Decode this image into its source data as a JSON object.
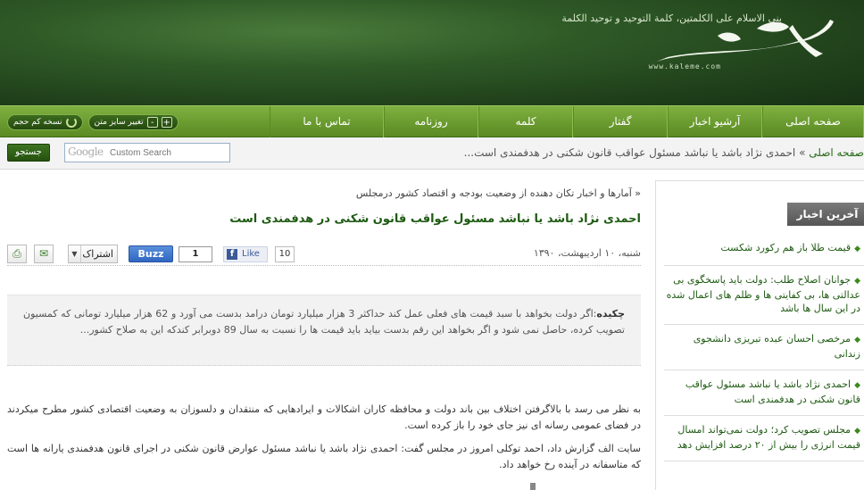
{
  "header": {
    "slogan": "بنی الاسلام علی الکلمتین، کلمة التوحید و توحید الکلمة",
    "logo_text": "کلمه",
    "logo_url": "www.kaleme.com"
  },
  "nav": {
    "items": [
      "صفحه اصلی",
      "آرشیو اخبار",
      "گفتار",
      "کلمه",
      "روزنامه",
      "تماس با ما"
    ],
    "light_version_label": "نسخه کم حجم",
    "font_size_label": "تغییر سایز متن",
    "plus": "+",
    "minus": "-"
  },
  "breadcrumb": {
    "home": "صفحه اصلی",
    "sep": " » ",
    "current": "احمدی نژاد باشد یا نباشد مسئول عواقب قانون شکنی در هدفمندی است..."
  },
  "search": {
    "google_word": "Google",
    "placeholder": "Custom Search",
    "button": "جستجو"
  },
  "article": {
    "kicker": "« آمارها و اخبار تکان دهنده از وضعیت بودجه و اقتصاد کشور درمجلس",
    "title": "احمدی نژاد باشد یا نباشد مسئول عواقب قانون شکنی در هدفمندی است",
    "date": "شنبه، ۱۰ اردیبهشت، ۱۳۹۰",
    "like_count": "10",
    "like_label": "Like",
    "buzz_count": "1",
    "buzz_label": "Buzz",
    "share_label": "اشتراک",
    "summary_label": "چکیده",
    "summary": ":اگر دولت بخواهد با سبد قیمت های فعلی عمل کند حداکثر 3 هزار میلیارد تومان درامد بدست می آورد و 62 هزار میلیارد تومانی که کمسیون تصویب کرده، حاصل نمی شود و اگر بخواهد این رقم بدست بیاید باید قیمت ها را نسبت به سال 89 دوبرابر کندکه این به صلاح کشور...",
    "paragraphs": [
      "به نظر  می رسد با  بالاگرفتن  اختلاف بین باند دولت و محافظه کاران  اشکالات و ایرادهایی که منتقدان و دلسوزان به  وضعیت  اقتصادی کشور مطرح میکردند در  فضای عمومی رسانه ای نیز جای خود را باز کرده است.",
      "سایت الف  گزارش داد، احمد توکلی امروز در مجلس گفت: احمدی نژاد باشد یا نباشد مسئول عوارض قانون شکنی در اجرای قانون هدفمندی یارانه ها است که متاسفانه در آینده رخ خواهد داد."
    ]
  },
  "sidebar": {
    "heading": "آخرین اخبار",
    "items": [
      "قیمت طلا باز هم رکورد شکست",
      "جوانان اصلاح طلب: دولت باید پاسخگوی بی عدالتی ها، بی کفایتی ها و ظلم های اعمال شده در این سال ها باشد",
      "مرخصی احسان عبده تبریزی دانشجوی زندانی",
      "احمدی نژاد باشد یا نباشد مسئول عواقب قانون شکنی در هدفمندی است",
      "مجلس تصویب کرد؛ دولت نمی‌تواند امسال قیمت انرژی را بیش از ۲۰ درصد افزایش دهد"
    ]
  },
  "colors": {
    "header_green": "#2f5a27",
    "nav_green": "#6d9e30",
    "title_green": "#1e5a12"
  }
}
